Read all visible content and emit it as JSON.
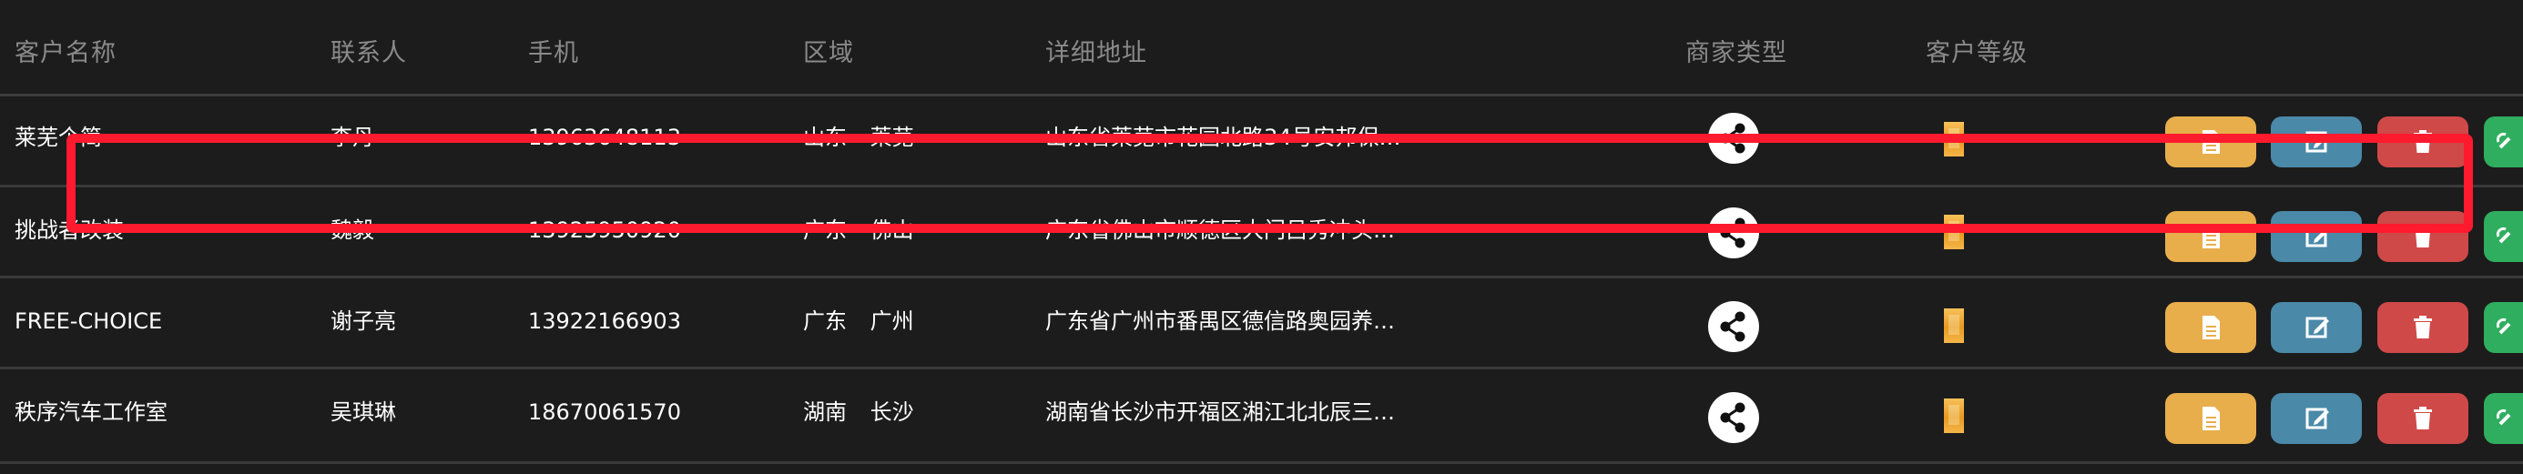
{
  "table": {
    "headers": {
      "name": "客户名称",
      "contact": "联系人",
      "phone": "手机",
      "region": "区域",
      "address": "详细地址",
      "merchant_type": "商家类型",
      "level": "客户等级"
    },
    "rows": [
      {
        "name": "莱芜个简",
        "contact": "李丹",
        "phone": "13963648113",
        "region": "山东 莱芜",
        "address": "山东省莱芜市花园北路34号安邦保…"
      },
      {
        "name": "挑战者改装",
        "contact": "魏毅",
        "phone": "13925950920",
        "region": "广东 佛山",
        "address": "广东省佛山市顺德区大门吕秀冲头…"
      },
      {
        "name": "FREE-CHOICE",
        "contact": "谢子亮",
        "phone": "13922166903",
        "region": "广东 广州",
        "address": "广东省广州市番禺区德信路奥园养…"
      },
      {
        "name": "秩序汽车工作室",
        "contact": "吴琪琳",
        "phone": "18670061570",
        "region": "湖南 长沙",
        "address": "湖南省长沙市开福区湘江北北辰三…"
      }
    ]
  },
  "icons": {
    "merchant_type": "share-icon",
    "level": "level-badge-icon",
    "view": "document-icon",
    "edit": "edit-icon",
    "delete": "trash-icon",
    "link": "link-icon"
  },
  "colors": {
    "background": "#1c1c1c",
    "view_button": "#e7ae4b",
    "edit_button": "#4a89a8",
    "delete_button": "#cf4948",
    "link_button": "#2fae5f",
    "highlight": "#ff1a2e"
  }
}
